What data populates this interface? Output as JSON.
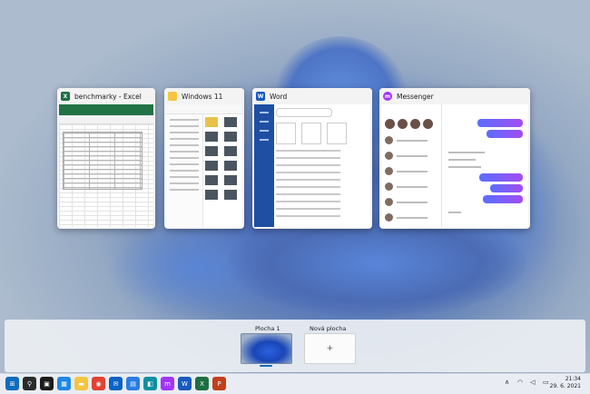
{
  "windows": [
    {
      "title": "benchmarky - Excel",
      "icon": "excel-icon",
      "color": "#1d6f42",
      "glyph": "X"
    },
    {
      "title": "Windows 11",
      "icon": "folder-icon",
      "color": "#f4c542",
      "glyph": ""
    },
    {
      "title": "Word",
      "icon": "word-icon",
      "color": "#185abd",
      "glyph": "W"
    },
    {
      "title": "Messenger",
      "icon": "messenger-icon",
      "color": "#a334fa",
      "glyph": "m"
    }
  ],
  "desktops": [
    {
      "label": "Plocha 1"
    },
    {
      "label": "Nová plocha",
      "add_glyph": "+"
    }
  ],
  "taskbar": {
    "items": [
      {
        "name": "start-icon",
        "glyph": "⊞",
        "color": "#0f6cbd"
      },
      {
        "name": "search-icon",
        "glyph": "⚲",
        "color": "#2b2b2b"
      },
      {
        "name": "task-view-icon",
        "glyph": "▣",
        "color": "#1b1b1b"
      },
      {
        "name": "widgets-icon",
        "glyph": "▦",
        "color": "#1e88e5"
      },
      {
        "name": "file-explorer-icon",
        "glyph": "▬",
        "color": "#f4c542"
      },
      {
        "name": "chrome-icon",
        "glyph": "◉",
        "color": "#e34133"
      },
      {
        "name": "mail-icon",
        "glyph": "✉",
        "color": "#0b63c4"
      },
      {
        "name": "store-icon",
        "glyph": "▤",
        "color": "#2a7de1"
      },
      {
        "name": "teams-chat-icon",
        "glyph": "◧",
        "color": "#0e8fa3"
      },
      {
        "name": "messenger-icon",
        "glyph": "m",
        "color": "#a334fa"
      },
      {
        "name": "word-icon",
        "glyph": "W",
        "color": "#185abd"
      },
      {
        "name": "excel-icon",
        "glyph": "X",
        "color": "#1d6f42"
      },
      {
        "name": "powerpoint-icon",
        "glyph": "P",
        "color": "#c43e1c"
      }
    ],
    "tray": {
      "chevron": "∧",
      "wifi": "◠",
      "sound": "◁",
      "battery": "▭"
    },
    "clock": {
      "time": "21:34",
      "date": "29. 6. 2021"
    }
  }
}
